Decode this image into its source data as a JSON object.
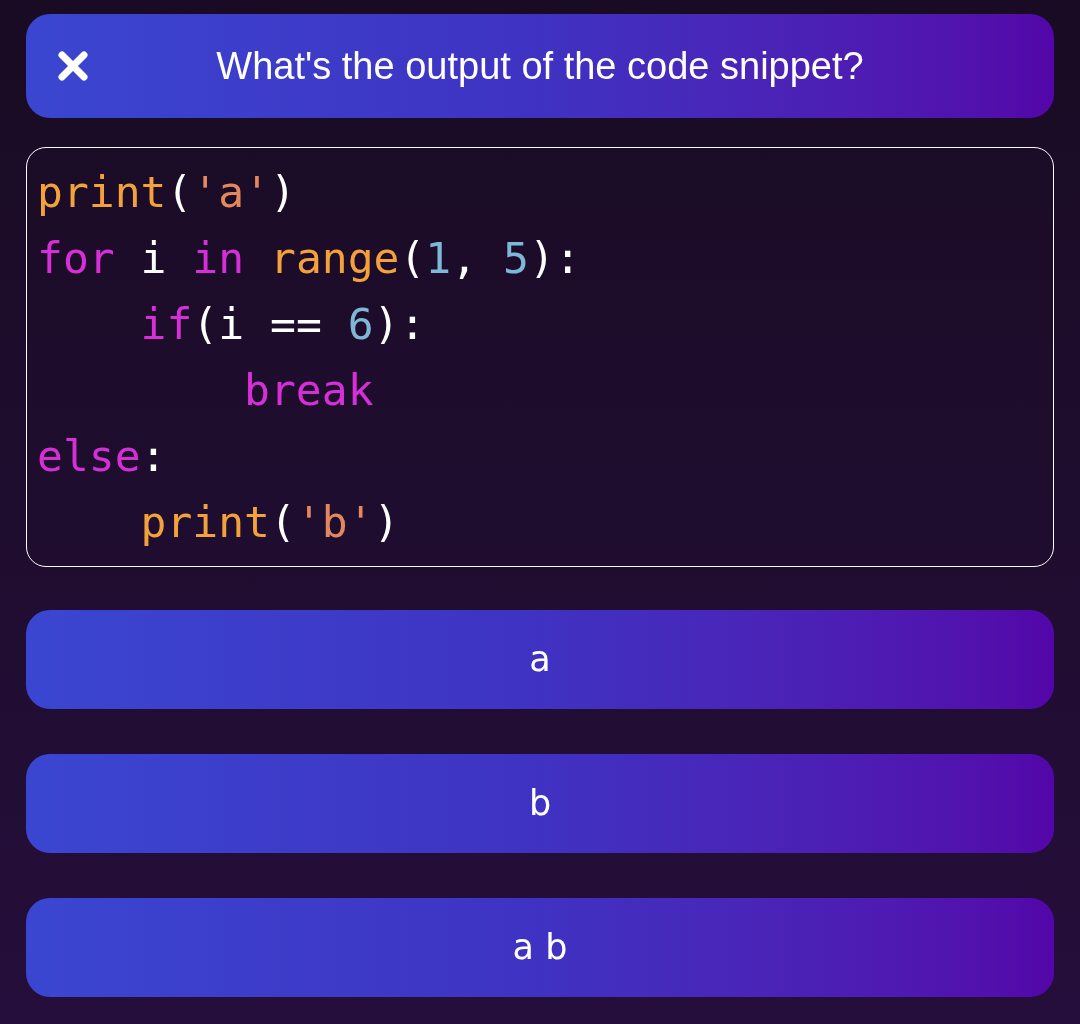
{
  "header": {
    "title": "What's the output of the code snippet?"
  },
  "code": {
    "lines": [
      {
        "tokens": [
          {
            "text": "print",
            "kind": "function"
          },
          {
            "text": "(",
            "kind": "plain"
          },
          {
            "text": "'a'",
            "kind": "string"
          },
          {
            "text": ")",
            "kind": "plain"
          }
        ]
      },
      {
        "tokens": [
          {
            "text": "for",
            "kind": "keyword"
          },
          {
            "text": " i ",
            "kind": "plain"
          },
          {
            "text": "in ",
            "kind": "keyword"
          },
          {
            "text": "range",
            "kind": "function"
          },
          {
            "text": "(",
            "kind": "plain"
          },
          {
            "text": "1",
            "kind": "number"
          },
          {
            "text": ", ",
            "kind": "plain"
          },
          {
            "text": "5",
            "kind": "number"
          },
          {
            "text": "):",
            "kind": "plain"
          }
        ],
        "children": [
          {
            "tokens": [
              {
                "text": "if",
                "kind": "keyword"
              },
              {
                "text": "(i == ",
                "kind": "plain"
              },
              {
                "text": "6",
                "kind": "number"
              },
              {
                "text": "):",
                "kind": "plain"
              }
            ],
            "children": [
              {
                "tokens": [
                  {
                    "text": "break",
                    "kind": "keyword"
                  }
                ]
              }
            ]
          }
        ]
      },
      {
        "tokens": [
          {
            "text": "else",
            "kind": "keyword"
          },
          {
            "text": ":",
            "kind": "plain"
          }
        ],
        "children": [
          {
            "tokens": [
              {
                "text": "print",
                "kind": "function"
              },
              {
                "text": "(",
                "kind": "plain"
              },
              {
                "text": "'b'",
                "kind": "string"
              },
              {
                "text": ")",
                "kind": "plain"
              }
            ]
          }
        ]
      }
    ]
  },
  "options": [
    {
      "label": "a"
    },
    {
      "label": "b"
    },
    {
      "label": "a b"
    }
  ]
}
